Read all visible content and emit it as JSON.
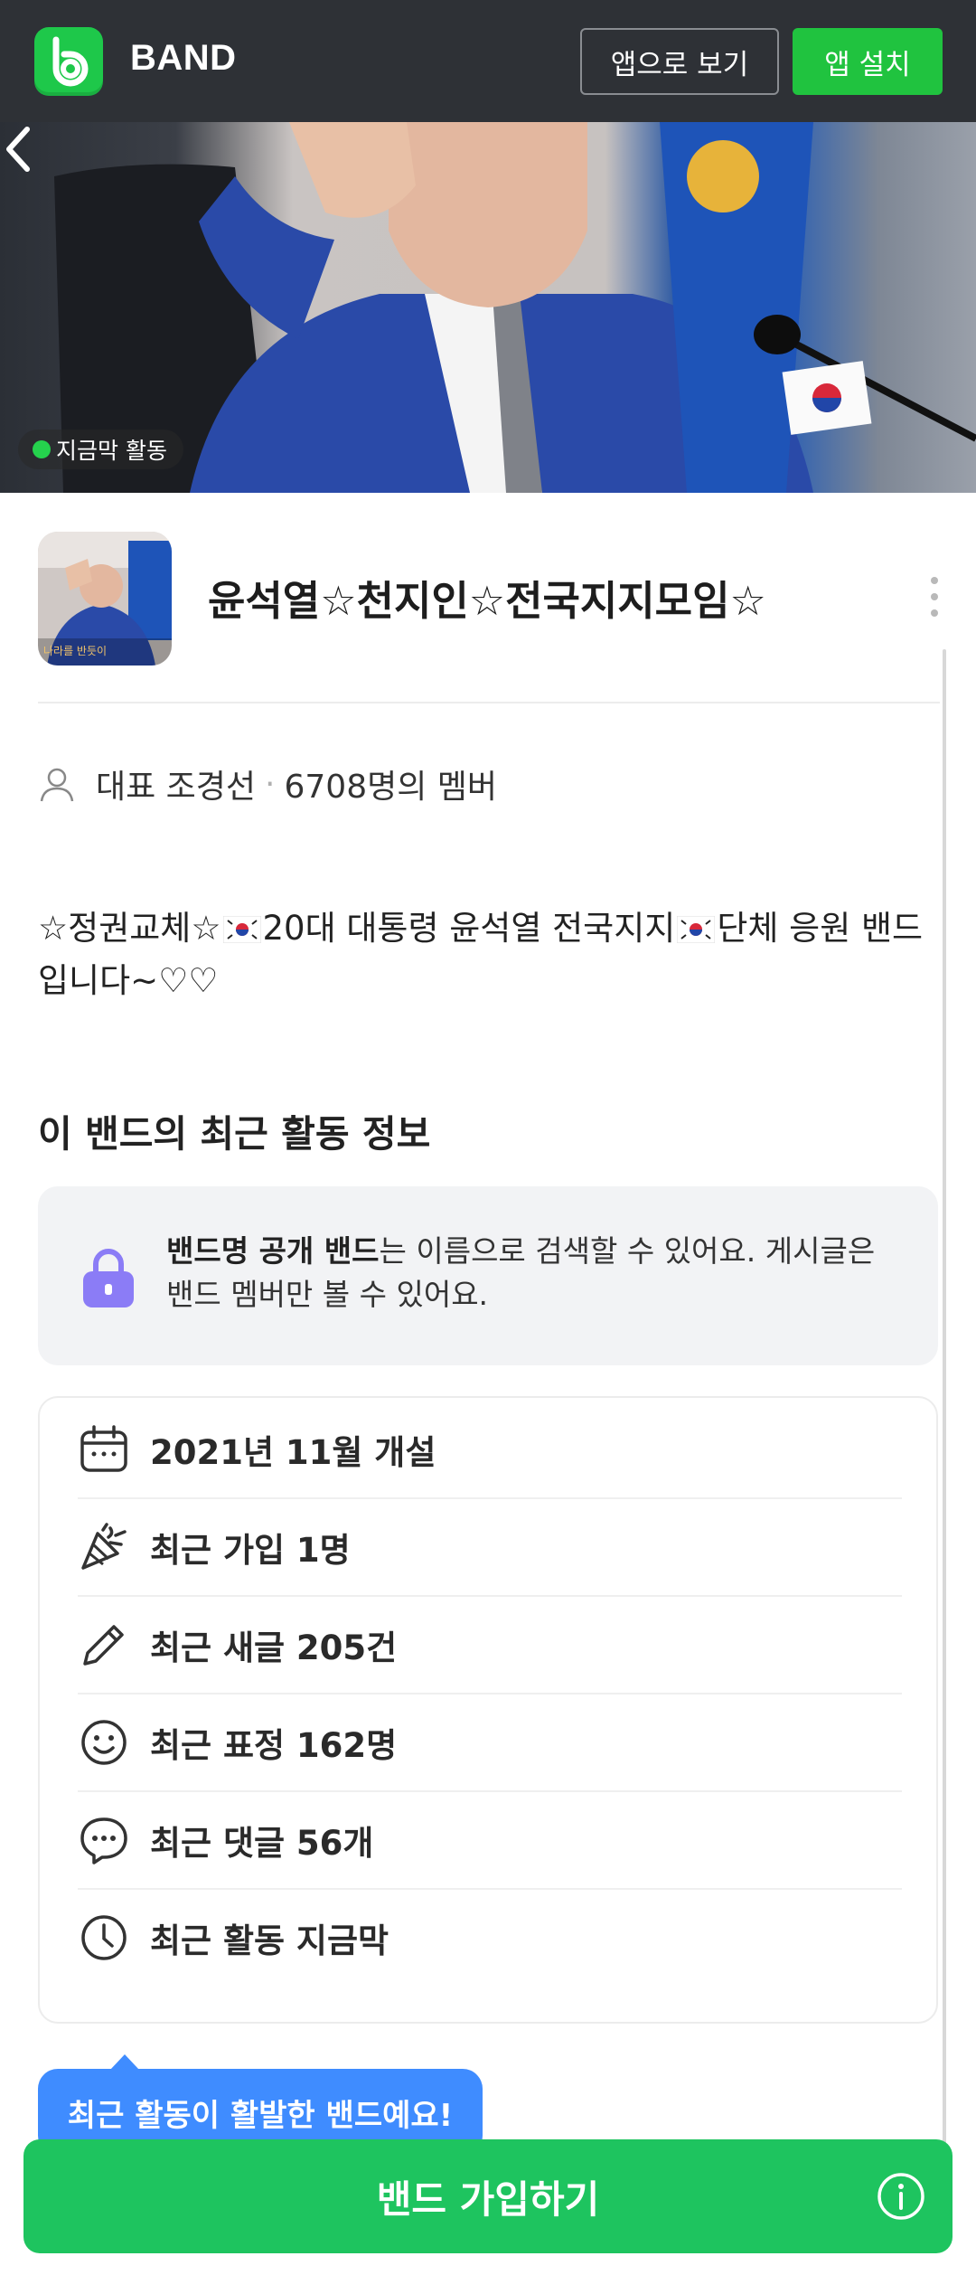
{
  "header": {
    "brand": "BAND",
    "view_in_app": "앱으로 보기",
    "install_app": "앱 설치"
  },
  "cover": {
    "status": "지금막 활동"
  },
  "band": {
    "name": "윤석열☆천지인☆전국지지모임☆",
    "leader_label": "대표 조경선",
    "members": "6708명의 멤버",
    "description_parts": [
      "☆정권교체☆",
      "20대 대통령 윤석열 전국지지",
      "단체 응원 밴드입니다~♡♡"
    ],
    "thumb_caption": "나라를 반듯이"
  },
  "activity": {
    "title": "이 밴드의 최근 활동 정보",
    "notice_bold": "밴드명 공개 밴드",
    "notice_rest": "는 이름으로 검색할 수 있어요. 게시글은 밴드 멤버만 볼 수 있어요.",
    "rows": [
      {
        "icon": "calendar-icon",
        "label": "2021년 11월 개설"
      },
      {
        "icon": "party-popper-icon",
        "label": "최근 가입 1명"
      },
      {
        "icon": "pencil-icon",
        "label": "최근 새글 205건"
      },
      {
        "icon": "smiley-icon",
        "label": "최근 표정 162명"
      },
      {
        "icon": "chat-bubble-icon",
        "label": "최근 댓글 56개"
      },
      {
        "icon": "clock-icon",
        "label": "최근 활동 지금막"
      }
    ]
  },
  "footer": {
    "tooltip": "최근 활동이 활발한 밴드예요!",
    "join_label": "밴드 가입하기"
  },
  "colors": {
    "header_bg": "#2e3136",
    "brand_green": "#20c33f",
    "join_green": "#1ec45f",
    "tooltip_blue": "#3f8cff",
    "lock_purple": "#8b7cf6"
  }
}
